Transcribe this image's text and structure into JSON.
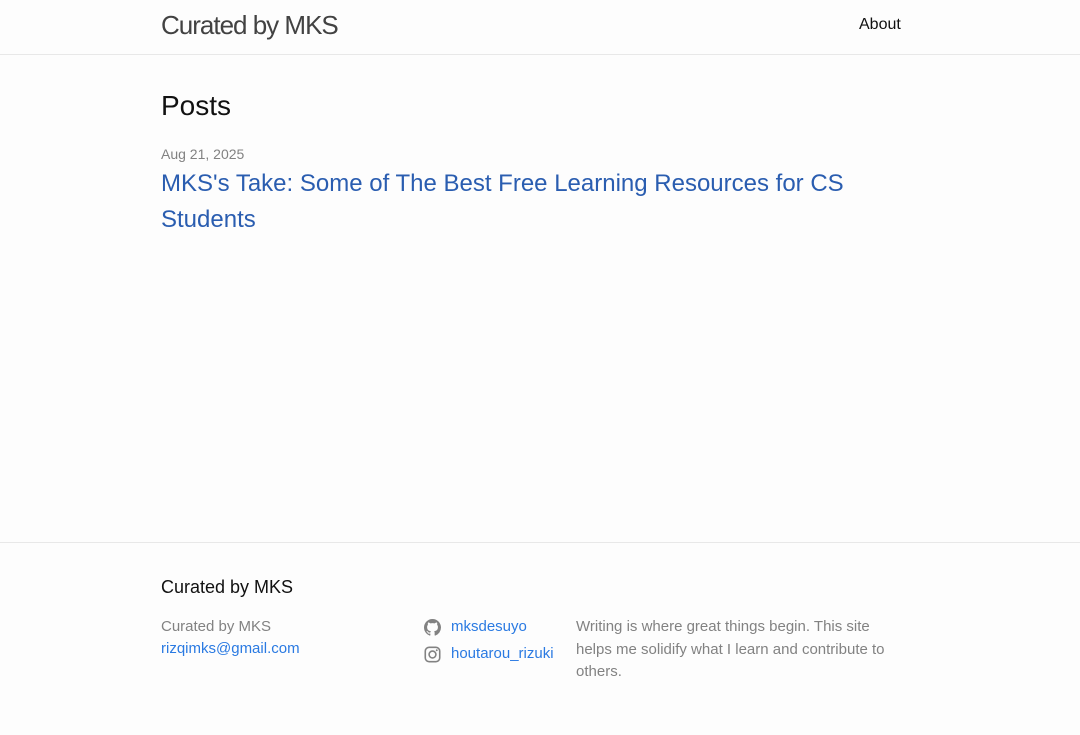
{
  "header": {
    "site_title": "Curated by MKS",
    "nav": {
      "about": "About"
    }
  },
  "main": {
    "heading": "Posts",
    "posts": [
      {
        "date": "Aug 21, 2025",
        "title": "MKS's Take: Some of The Best Free Learning Resources for CS Students"
      }
    ]
  },
  "footer": {
    "heading": "Curated by MKS",
    "name": "Curated by MKS",
    "email": "rizqimks@gmail.com",
    "social": {
      "github": {
        "icon": "github-icon",
        "username": "mksdesuyo"
      },
      "instagram": {
        "icon": "instagram-icon",
        "username": "houtarou_rizuki"
      }
    },
    "description": "Writing is where great things begin. This site helps me solidify what I learn and contribute to others."
  },
  "colors": {
    "link": "#2a5db0",
    "footer_link": "#2a7ae2",
    "muted": "#828282",
    "background": "#fdfdfd"
  }
}
